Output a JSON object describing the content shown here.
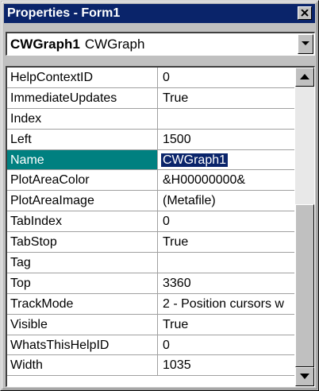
{
  "window": {
    "title": "Properties - Form1",
    "close_icon": "close-icon"
  },
  "object_selector": {
    "name": "CWGraph1",
    "type": "CWGraph",
    "dropdown_icon": "chevron-down-icon"
  },
  "properties": [
    {
      "name": "HelpContextID",
      "value": "0"
    },
    {
      "name": "ImmediateUpdates",
      "value": "True"
    },
    {
      "name": "Index",
      "value": ""
    },
    {
      "name": "Left",
      "value": "1500"
    },
    {
      "name": "Name",
      "value": "CWGraph1",
      "selected": true
    },
    {
      "name": "PlotAreaColor",
      "value": "&H00000000&"
    },
    {
      "name": "PlotAreaImage",
      "value": "(Metafile)"
    },
    {
      "name": "TabIndex",
      "value": "0"
    },
    {
      "name": "TabStop",
      "value": "True"
    },
    {
      "name": "Tag",
      "value": ""
    },
    {
      "name": "Top",
      "value": "3360"
    },
    {
      "name": "TrackMode",
      "value": "2 - Position cursors w"
    },
    {
      "name": "Visible",
      "value": "True"
    },
    {
      "name": "WhatsThisHelpID",
      "value": "0"
    },
    {
      "name": "Width",
      "value": "1035"
    }
  ],
  "colors": {
    "titlebar": "#0a246a",
    "selected_row": "#008080",
    "face": "#c0c0c0"
  }
}
